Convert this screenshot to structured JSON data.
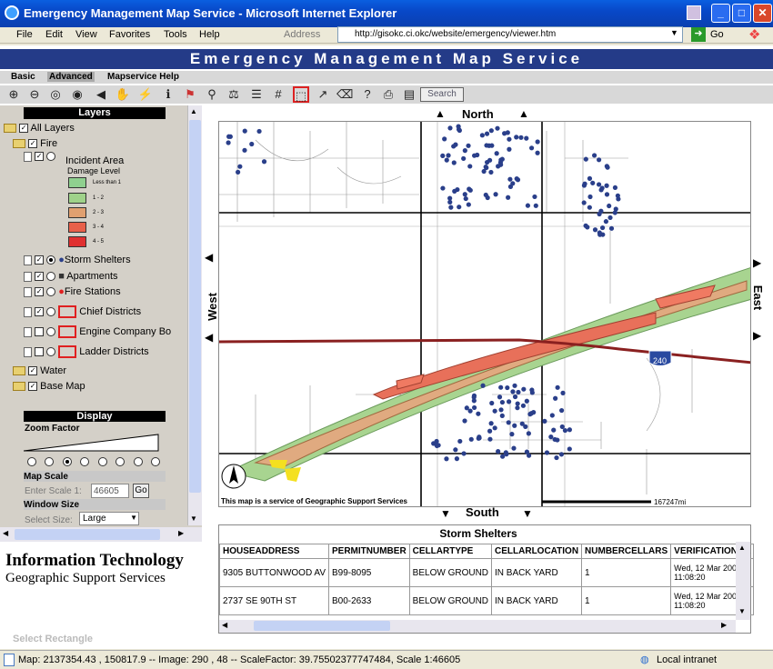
{
  "window": {
    "title": "Emergency Management Map Service - Microsoft Internet Explorer"
  },
  "menu": [
    "File",
    "Edit",
    "View",
    "Favorites",
    "Tools",
    "Help"
  ],
  "address": {
    "label": "Address",
    "url": "http://gisokc.ci.okc/website/emergency/viewer.htm",
    "go": "Go"
  },
  "app": {
    "title": "Emergency Management Map Service"
  },
  "tabs": [
    "Basic",
    "Advanced",
    "Mapservice Help"
  ],
  "toolbar": {
    "search": "Search"
  },
  "layers": {
    "header": "Layers",
    "all": "All Layers",
    "fire": "Fire",
    "incident": "Incident Area",
    "damage_level": "Damage Level",
    "damage": [
      {
        "label": "Less than 1",
        "color": "#8fd08f"
      },
      {
        "label": "1 - 2",
        "color": "#9fd28a"
      },
      {
        "label": "2 - 3",
        "color": "#e0a070"
      },
      {
        "label": "3 - 4",
        "color": "#e8604a"
      },
      {
        "label": "4 - 5",
        "color": "#e03030"
      }
    ],
    "storm": "Storm Shelters",
    "apartments": "Apartments",
    "fire_stations": "Fire Stations",
    "chief": "Chief Districts",
    "engine": "Engine Company Bo",
    "ladder": "Ladder Districts",
    "water": "Water",
    "base": "Base Map"
  },
  "display": {
    "header": "Display",
    "zoom_factor": "Zoom Factor",
    "map_scale": "Map Scale",
    "enter_scale": "Enter Scale 1:",
    "scale_value": "46605",
    "go": "Go",
    "window_size": "Window Size",
    "select_size": "Select Size:",
    "size_value": "Large"
  },
  "brand": {
    "line1": "Information Technology",
    "line2": "Geographic Support Services"
  },
  "select_rect": "Select Rectangle",
  "map": {
    "north": "North",
    "south": "South",
    "east": "East",
    "west": "West",
    "credit": "This map is a service of Geographic Support Services",
    "scalebar": "167247mi",
    "interstate": "240"
  },
  "table": {
    "title": "Storm Shelters",
    "columns": [
      "HOUSEADDRESS",
      "PERMITNUMBER",
      "CELLARTYPE",
      "CELLARLOCATION",
      "NUMBERCELLARS",
      "VERIFICATIONDA"
    ],
    "rows": [
      [
        "9305  BUTTONWOOD AV",
        "B99-8095",
        "BELOW GROUND",
        "IN BACK YARD",
        "1",
        "Wed, 12 Mar 200 11:08:20"
      ],
      [
        "2737 SE 90TH ST",
        "B00-2633",
        "BELOW GROUND",
        "IN BACK YARD",
        "1",
        "Wed, 12 Mar 200 11:08:20"
      ]
    ]
  },
  "status": {
    "text": "Map: 2137354.43 , 150817.9 -- Image: 290 , 48 -- ScaleFactor: 39.75502377747484,  Scale 1:46605",
    "zone": "Local intranet"
  }
}
